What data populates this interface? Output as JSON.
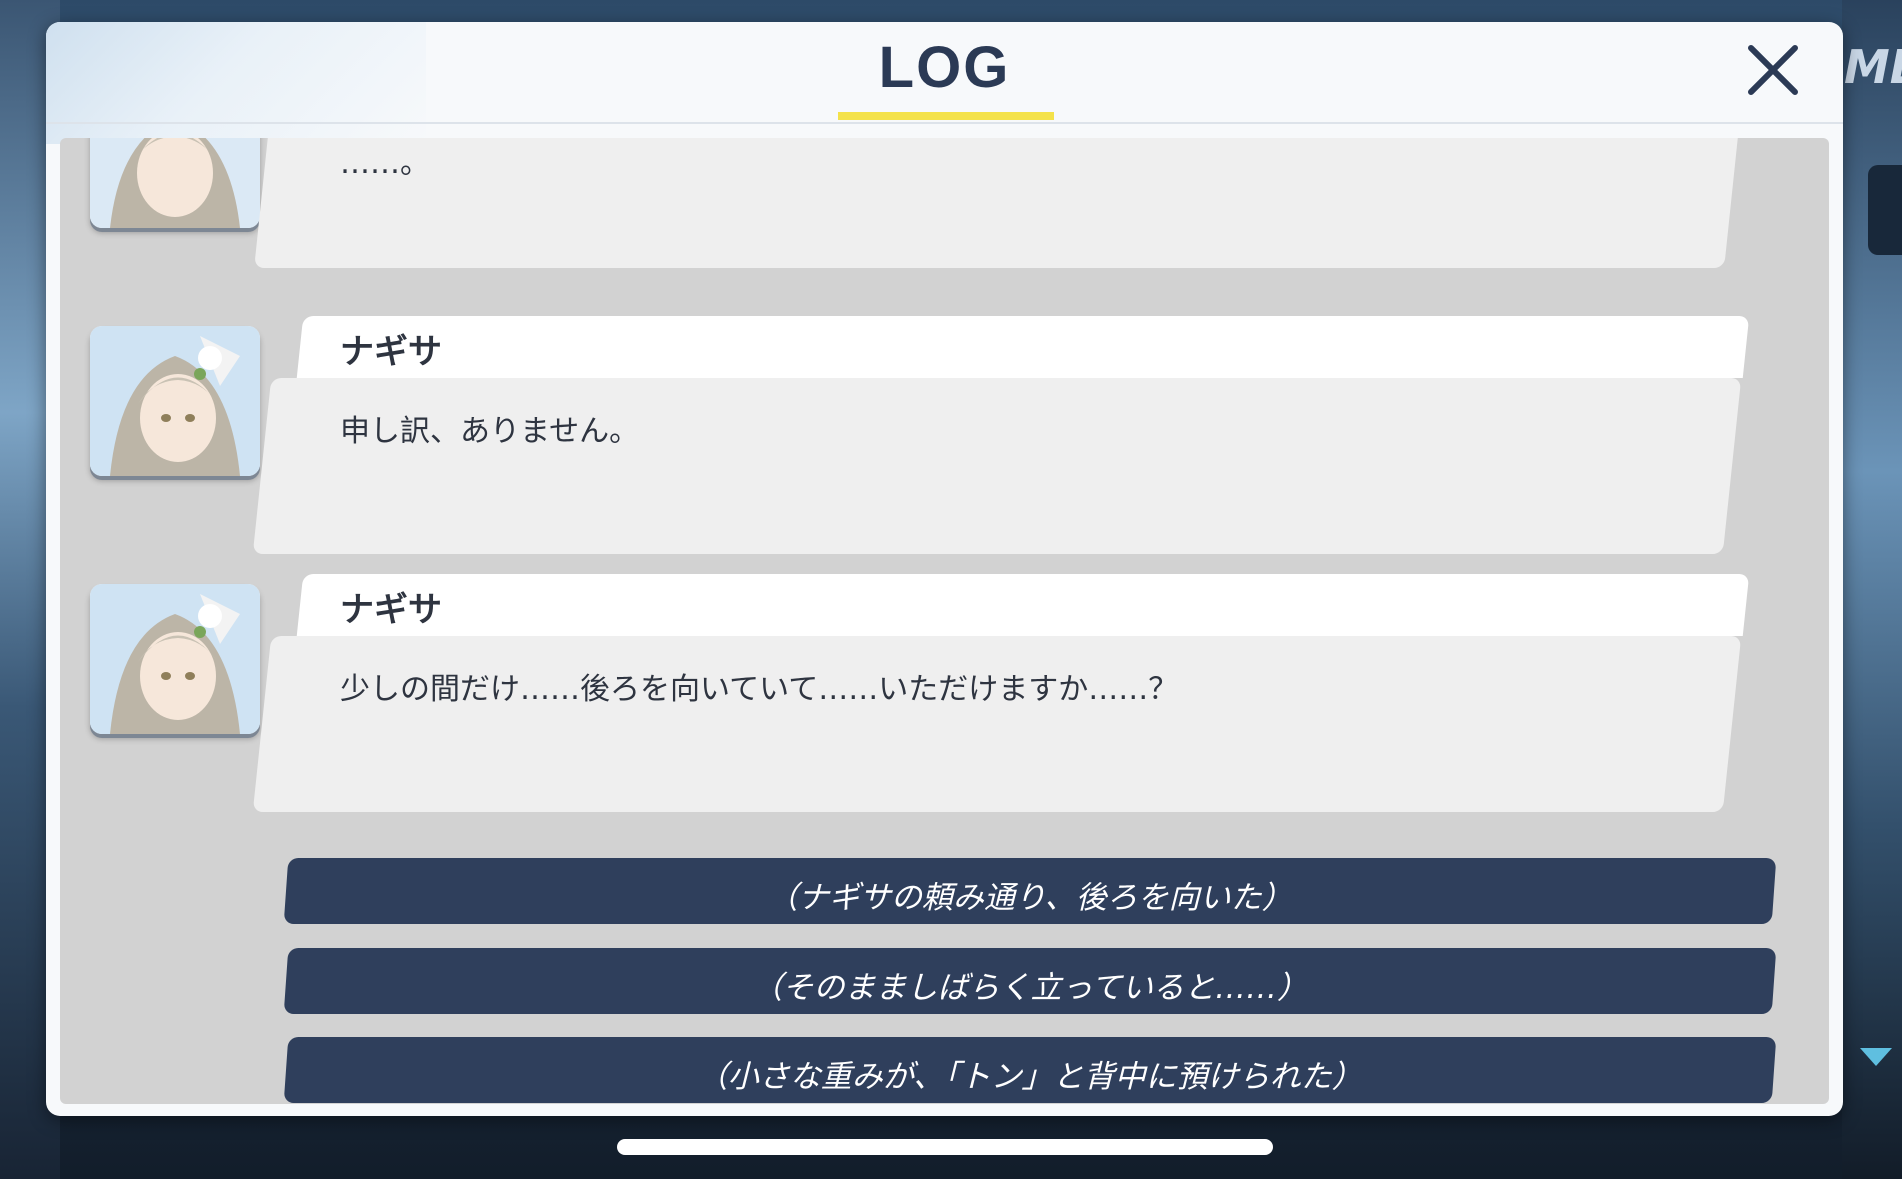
{
  "window": {
    "title": "LOG"
  },
  "background": {
    "right_edge_text": "ME"
  },
  "entries": [
    {
      "speaker": "",
      "text": "……。"
    },
    {
      "speaker": "ナギサ",
      "text": "申し訳、ありません。"
    },
    {
      "speaker": "ナギサ",
      "text": "少しの間だけ……後ろを向いていて……いただけますか……？"
    }
  ],
  "choices": [
    "（ナギサの頼み通り、後ろを向いた）",
    "（そのまましばらく立っていると……）",
    "（小さな重みが、「トン」と背中に預けられた）"
  ],
  "icons": {
    "close": "close-icon",
    "scroll": "scroll-down-arrow-icon"
  },
  "colors": {
    "title": "#2b3a55",
    "underline": "#f4e24a",
    "choice_bg": "#2f3f5c"
  }
}
